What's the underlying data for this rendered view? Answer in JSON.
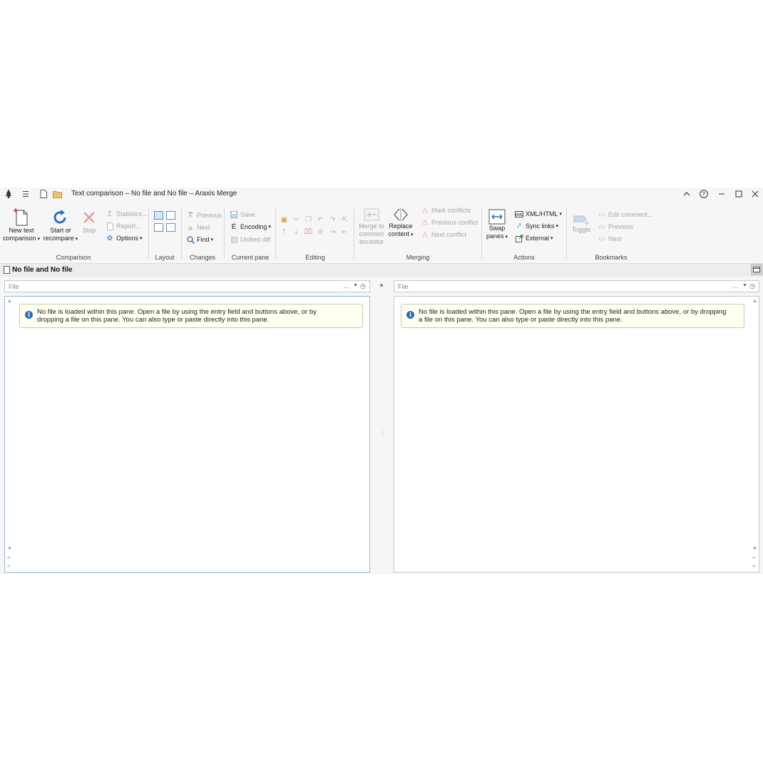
{
  "window": {
    "title": "Text comparison – No file and No file – Araxis Merge",
    "controls": [
      "chevron-up-icon",
      "help-icon",
      "minimize-icon",
      "maximize-icon",
      "close-icon"
    ]
  },
  "ribbon": {
    "comparison": {
      "label": "Comparison",
      "new_text_line1": "New text",
      "new_text_line2": "comparison",
      "start_line1": "Start or",
      "start_line2": "recompare",
      "stop": "Stop",
      "statistics": "Statistics...",
      "report": "Report...",
      "options": "Options"
    },
    "layout": {
      "label": "Layout"
    },
    "changes": {
      "label": "Changes",
      "previous": "Previous",
      "next": "Next",
      "find": "Find"
    },
    "current_pane": {
      "label": "Current pane",
      "save": "Save",
      "encoding": "Encoding",
      "unified_diff": "Unified diff"
    },
    "editing": {
      "label": "Editing"
    },
    "merging": {
      "label": "Merging",
      "merge_line1": "Merge to",
      "merge_line2": "common",
      "merge_line3": "ancestor",
      "replace_line1": "Replace",
      "replace_line2": "content",
      "mark_conflicts": "Mark conflicts",
      "previous_conflict": "Previous conflict",
      "next_conflict": "Next conflict"
    },
    "actions": {
      "label": "Actions",
      "swap_line1": "Swap",
      "swap_line2": "panes",
      "xml_html": "XML/HTML",
      "sync_links": "Sync links",
      "external": "External"
    },
    "bookmarks": {
      "label": "Bookmarks",
      "toggle": "Toggle",
      "edit_comment": "Edit comment...",
      "previous": "Previous",
      "next": "Next"
    }
  },
  "document": {
    "tab_title": "No file and No file"
  },
  "left_pane": {
    "file_placeholder": "File",
    "notice_line1": "No file is loaded within this pane. Open a file by using the entry field and buttons above, or by",
    "notice_line2": "dropping a file on this pane. You can also type or paste directly into this pane."
  },
  "right_pane": {
    "file_placeholder": "File",
    "notice_line1": "No file is loaded within this pane. Open a file by using the entry field and buttons above, or by dropping",
    "notice_line2": "a file on this pane. You can also type or paste directly into this pane."
  }
}
